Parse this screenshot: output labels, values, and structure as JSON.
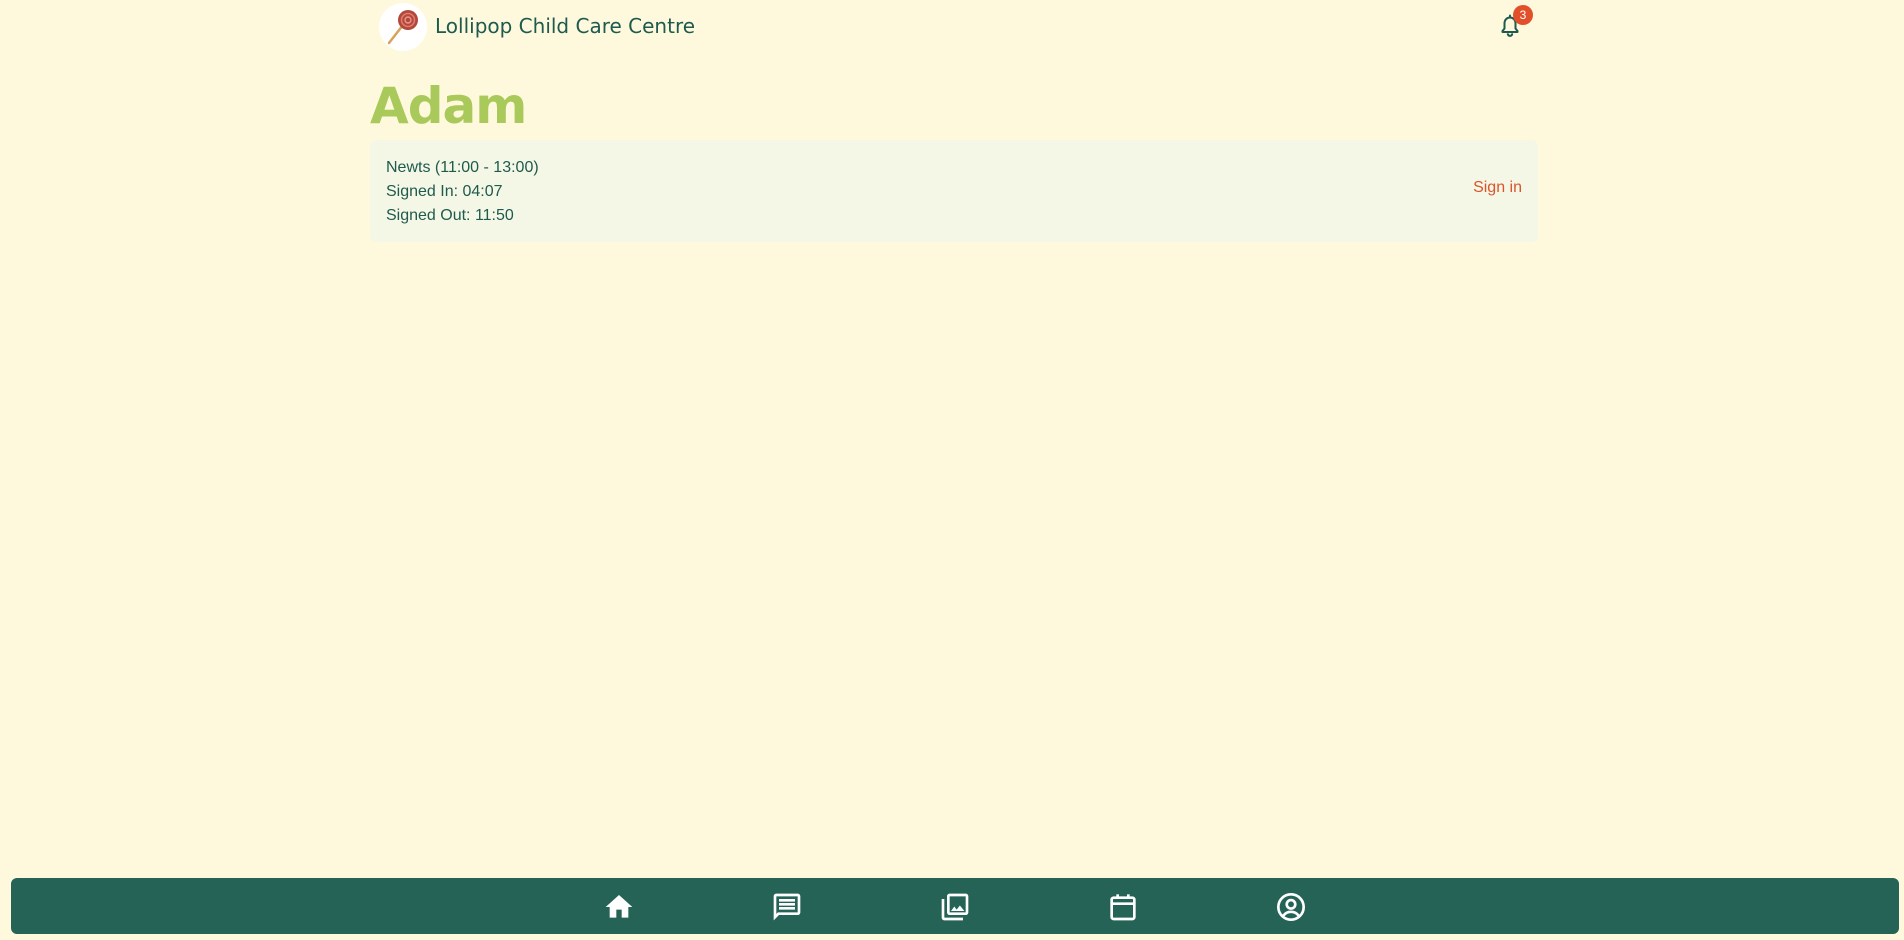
{
  "header": {
    "title": "Lollipop Child Care Centre",
    "notification_count": "3"
  },
  "child": {
    "name": "Adam"
  },
  "session": {
    "room": "Newts (11:00 - 13:00)",
    "signed_in": "Signed In: 04:07",
    "signed_out": "Signed Out: 11:50",
    "action_label": "Sign in"
  },
  "nav": {
    "items": [
      {
        "icon": "home-icon"
      },
      {
        "icon": "messages-icon"
      },
      {
        "icon": "gallery-icon"
      },
      {
        "icon": "calendar-icon"
      },
      {
        "icon": "profile-icon"
      }
    ]
  },
  "colors": {
    "background": "#fef9dc",
    "primary": "#246356",
    "accent": "#a9c95a",
    "link": "#d9552b",
    "badge": "#e2502b"
  }
}
